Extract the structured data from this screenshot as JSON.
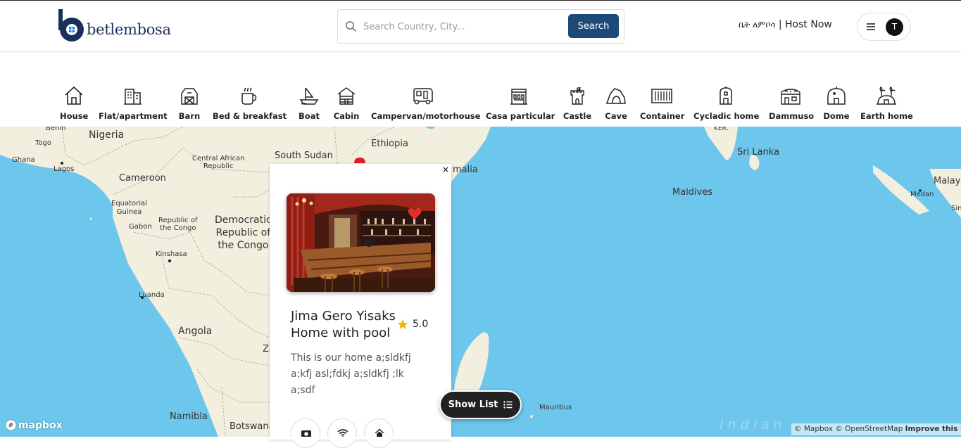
{
  "header": {
    "logo_text": "betlembosa",
    "search": {
      "placeholder": "Search Country, City...",
      "button_label": "Search"
    },
    "host_amharic": "ቤት ለምቦሳ",
    "host_separator": "|",
    "host_label": "Host Now",
    "avatar_initial": "T"
  },
  "categories": [
    {
      "label": "House",
      "icon": "house-icon"
    },
    {
      "label": "Flat/apartment",
      "icon": "building-icon"
    },
    {
      "label": "Barn",
      "icon": "barn-icon"
    },
    {
      "label": "Bed & breakfast",
      "icon": "coffee-cup-icon"
    },
    {
      "label": "Boat",
      "icon": "boat-icon"
    },
    {
      "label": "Cabin",
      "icon": "cabin-icon"
    },
    {
      "label": "Campervan/motorhouse",
      "icon": "campervan-icon"
    },
    {
      "label": "Casa particular",
      "icon": "casa-icon"
    },
    {
      "label": "Castle",
      "icon": "castle-icon"
    },
    {
      "label": "Cave",
      "icon": "cave-icon"
    },
    {
      "label": "Container",
      "icon": "container-icon"
    },
    {
      "label": "Cycladic home",
      "icon": "cycladic-icon"
    },
    {
      "label": "Dammuso",
      "icon": "dammuso-icon"
    },
    {
      "label": "Dome",
      "icon": "dome-icon"
    },
    {
      "label": "Earth home",
      "icon": "earth-home-icon"
    }
  ],
  "map": {
    "labels": {
      "benin": "Benin",
      "nigeria": "Nigeria",
      "togo": "Togo",
      "ghana": "Ghana",
      "lagos": "Lagos",
      "cameroon": "Cameroon",
      "car": "Central African\nRepublic",
      "south_sudan": "South Sudan",
      "ethiopia": "Ethiopia",
      "somalia": "malia",
      "eq_guinea": "Equatorial\nGuinea",
      "gabon": "Gabon",
      "roc": "Republic of\nthe Congo",
      "drc": "Democratic\nRepublic of\nthe Congo",
      "kinshasa": "Kinshasa",
      "luanda": "Luanda",
      "angola": "Angola",
      "zambia": "Za",
      "namibia": "Namibia",
      "botswana": "Botswana",
      "mauritius": "Mauritius",
      "indian": "Indian",
      "sri_lanka": "Sri Lanka",
      "maldives": "Maldives",
      "ker": "KER.",
      "medan": "Medan",
      "malay": "Malay",
      "sin": "Sin"
    },
    "brand": "mapbox",
    "attribution": "© Mapbox © OpenStreetMap",
    "improve": "Improve this map"
  },
  "popup": {
    "close": "×",
    "title": "Jima Gero Yisaks Home with pool",
    "rating": "5.0",
    "description": "This is our home a;sldkfj a;kfj asl;fdkj a;sldkfj ;lk a;sdf",
    "amenities": [
      "camera-icon",
      "wifi-icon",
      "home-icon"
    ]
  },
  "show_list_label": "Show List",
  "colors": {
    "water": "#6dc6ec",
    "land": "#f3efdf",
    "brand": "#1a2f5c",
    "search_button": "#1e4a7a",
    "star": "#f5b301",
    "heart": "#e0322b"
  }
}
